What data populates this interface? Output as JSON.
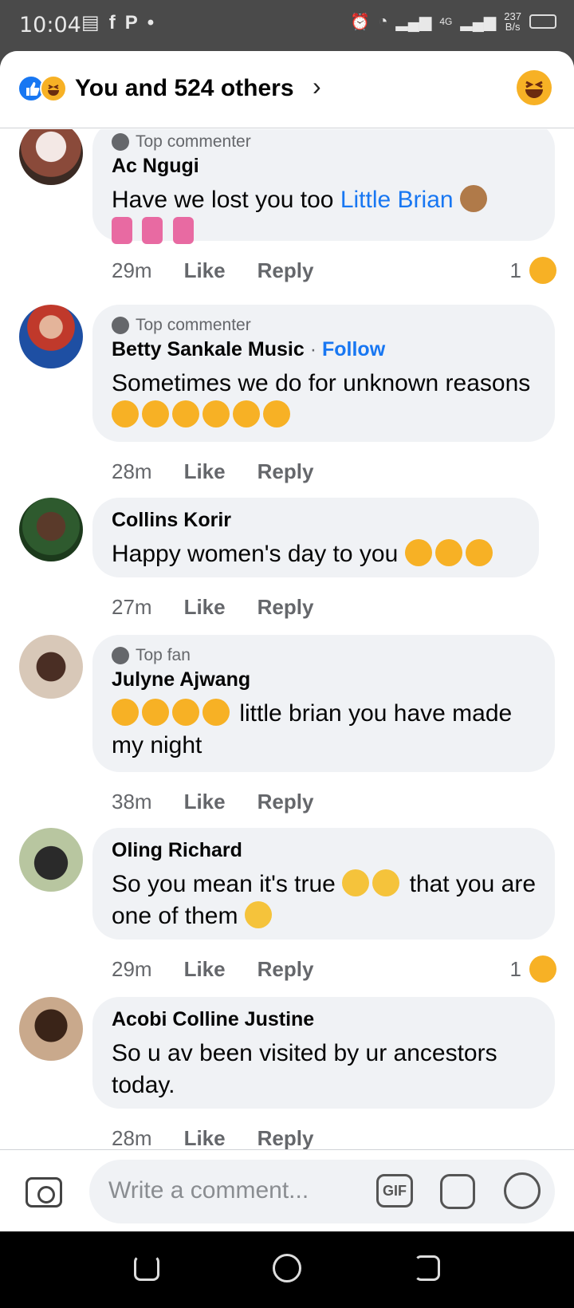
{
  "status_bar": {
    "time": "10:04",
    "speed_value": "237",
    "speed_unit": "B/s",
    "network": "4G"
  },
  "header": {
    "reactions_text": "You and 524 others",
    "chevron": "›"
  },
  "comments": [
    {
      "badge": "Top commenter",
      "author": "Ac Ngugi",
      "text_before_mention": "Have we lost you too ",
      "mention": "Little Brian",
      "time": "29m",
      "like_label": "Like",
      "reply_label": "Reply",
      "reaction_count": "1"
    },
    {
      "badge": "Top commenter",
      "author": "Betty Sankale Music",
      "separator": "·",
      "follow_label": "Follow",
      "text": "Sometimes we do for unknown reasons",
      "time": "28m",
      "like_label": "Like",
      "reply_label": "Reply"
    },
    {
      "author": "Collins Korir",
      "text": "Happy women's day to you",
      "time": "27m",
      "like_label": "Like",
      "reply_label": "Reply"
    },
    {
      "badge": "Top fan",
      "author": "Julyne Ajwang",
      "text": "little  brian you have made my night",
      "time": "38m",
      "like_label": "Like",
      "reply_label": "Reply"
    },
    {
      "author": "Oling Richard",
      "text_part1": "So you mean it's true",
      "text_part2": "that you are one of them",
      "time": "29m",
      "like_label": "Like",
      "reply_label": "Reply",
      "reaction_count": "1"
    },
    {
      "author": "Acobi Colline Justine",
      "text": "So u av been visited by ur ancestors today.",
      "time": "28m",
      "like_label": "Like",
      "reply_label": "Reply"
    }
  ],
  "composer": {
    "placeholder": "Write a comment...",
    "gif_label": "GIF"
  },
  "colors": {
    "link_blue": "#1877f2",
    "bubble_gray": "#f0f2f5",
    "haha_yellow": "#f7b125"
  }
}
